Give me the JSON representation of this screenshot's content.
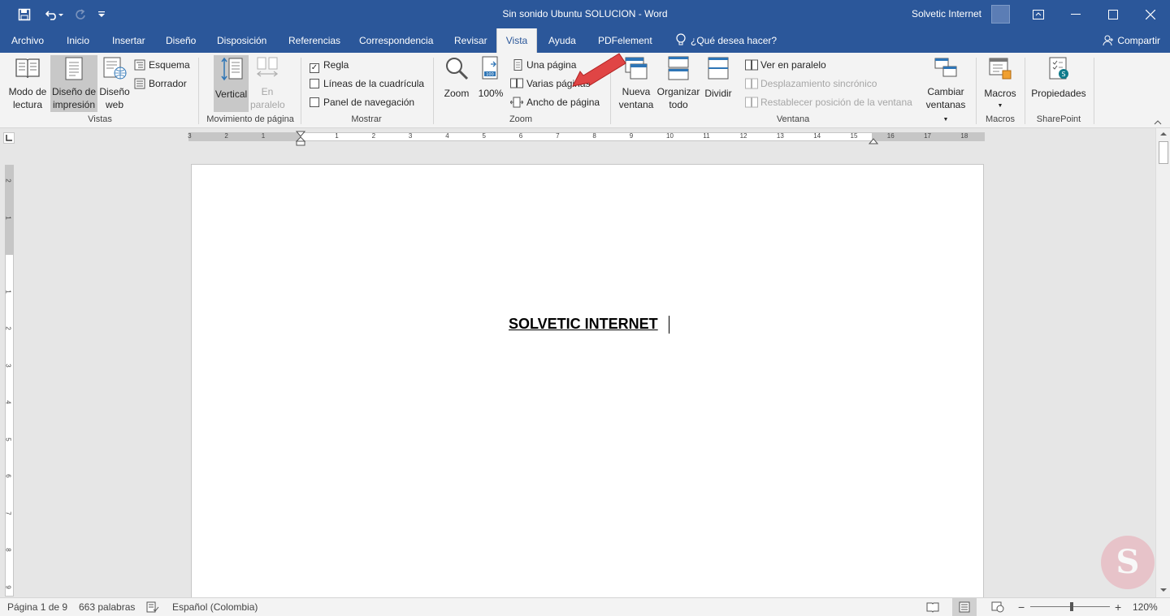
{
  "window": {
    "title": "Sin sonido Ubuntu SOLUCION  -  Word",
    "user": "Solvetic Internet"
  },
  "tabs": [
    {
      "label": "Archivo"
    },
    {
      "label": "Inicio"
    },
    {
      "label": "Insertar"
    },
    {
      "label": "Diseño"
    },
    {
      "label": "Disposición"
    },
    {
      "label": "Referencias"
    },
    {
      "label": "Correspondencia"
    },
    {
      "label": "Revisar"
    },
    {
      "label": "Vista",
      "active": true
    },
    {
      "label": "Ayuda"
    },
    {
      "label": "PDFelement"
    }
  ],
  "tell_me": "¿Qué desea hacer?",
  "share": "Compartir",
  "ribbon": {
    "vistas": {
      "modo_lectura": [
        "Modo de",
        "lectura"
      ],
      "diseno_impresion": [
        "Diseño de",
        "impresión"
      ],
      "diseno_web": [
        "Diseño",
        "web"
      ],
      "esquema": "Esquema",
      "borrador": "Borrador",
      "label": "Vistas"
    },
    "movimiento": {
      "vertical": "Vertical",
      "en_paralelo": [
        "En",
        "paralelo"
      ],
      "label": "Movimiento de página"
    },
    "mostrar": {
      "regla": "Regla",
      "lineas": "Líneas de la cuadrícula",
      "panel": "Panel de navegación",
      "label": "Mostrar"
    },
    "zoom": {
      "zoom": "Zoom",
      "cien": "100%",
      "una_pagina": "Una página",
      "varias_paginas": "Varias páginas",
      "ancho_pagina": "Ancho de página",
      "label": "Zoom"
    },
    "ventana": {
      "nueva": [
        "Nueva",
        "ventana"
      ],
      "organizar": [
        "Organizar",
        "todo"
      ],
      "dividir": "Dividir",
      "ver_paralelo": "Ver en paralelo",
      "desplazamiento": "Desplazamiento sincrónico",
      "restablecer": "Restablecer posición de la ventana",
      "cambiar": [
        "Cambiar",
        "ventanas"
      ],
      "label": "Ventana"
    },
    "macros": {
      "macros": "Macros",
      "label": "Macros"
    },
    "sharepoint": {
      "propiedades": "Propiedades",
      "label": "SharePoint"
    }
  },
  "ruler_top": [
    "3",
    "2",
    "1",
    "1",
    "2",
    "3",
    "4",
    "5",
    "6",
    "7",
    "8",
    "9",
    "10",
    "11",
    "12",
    "13",
    "14",
    "15",
    "16",
    "17",
    "18"
  ],
  "ruler_left": [
    "2",
    "1",
    "1",
    "2",
    "3",
    "4",
    "5",
    "6",
    "7",
    "8",
    "9"
  ],
  "document": {
    "text": "SOLVETIC INTERNET"
  },
  "status": {
    "page": "Página 1 de 9",
    "words": "663 palabras",
    "language": "Español (Colombia)",
    "zoom": "120%"
  }
}
